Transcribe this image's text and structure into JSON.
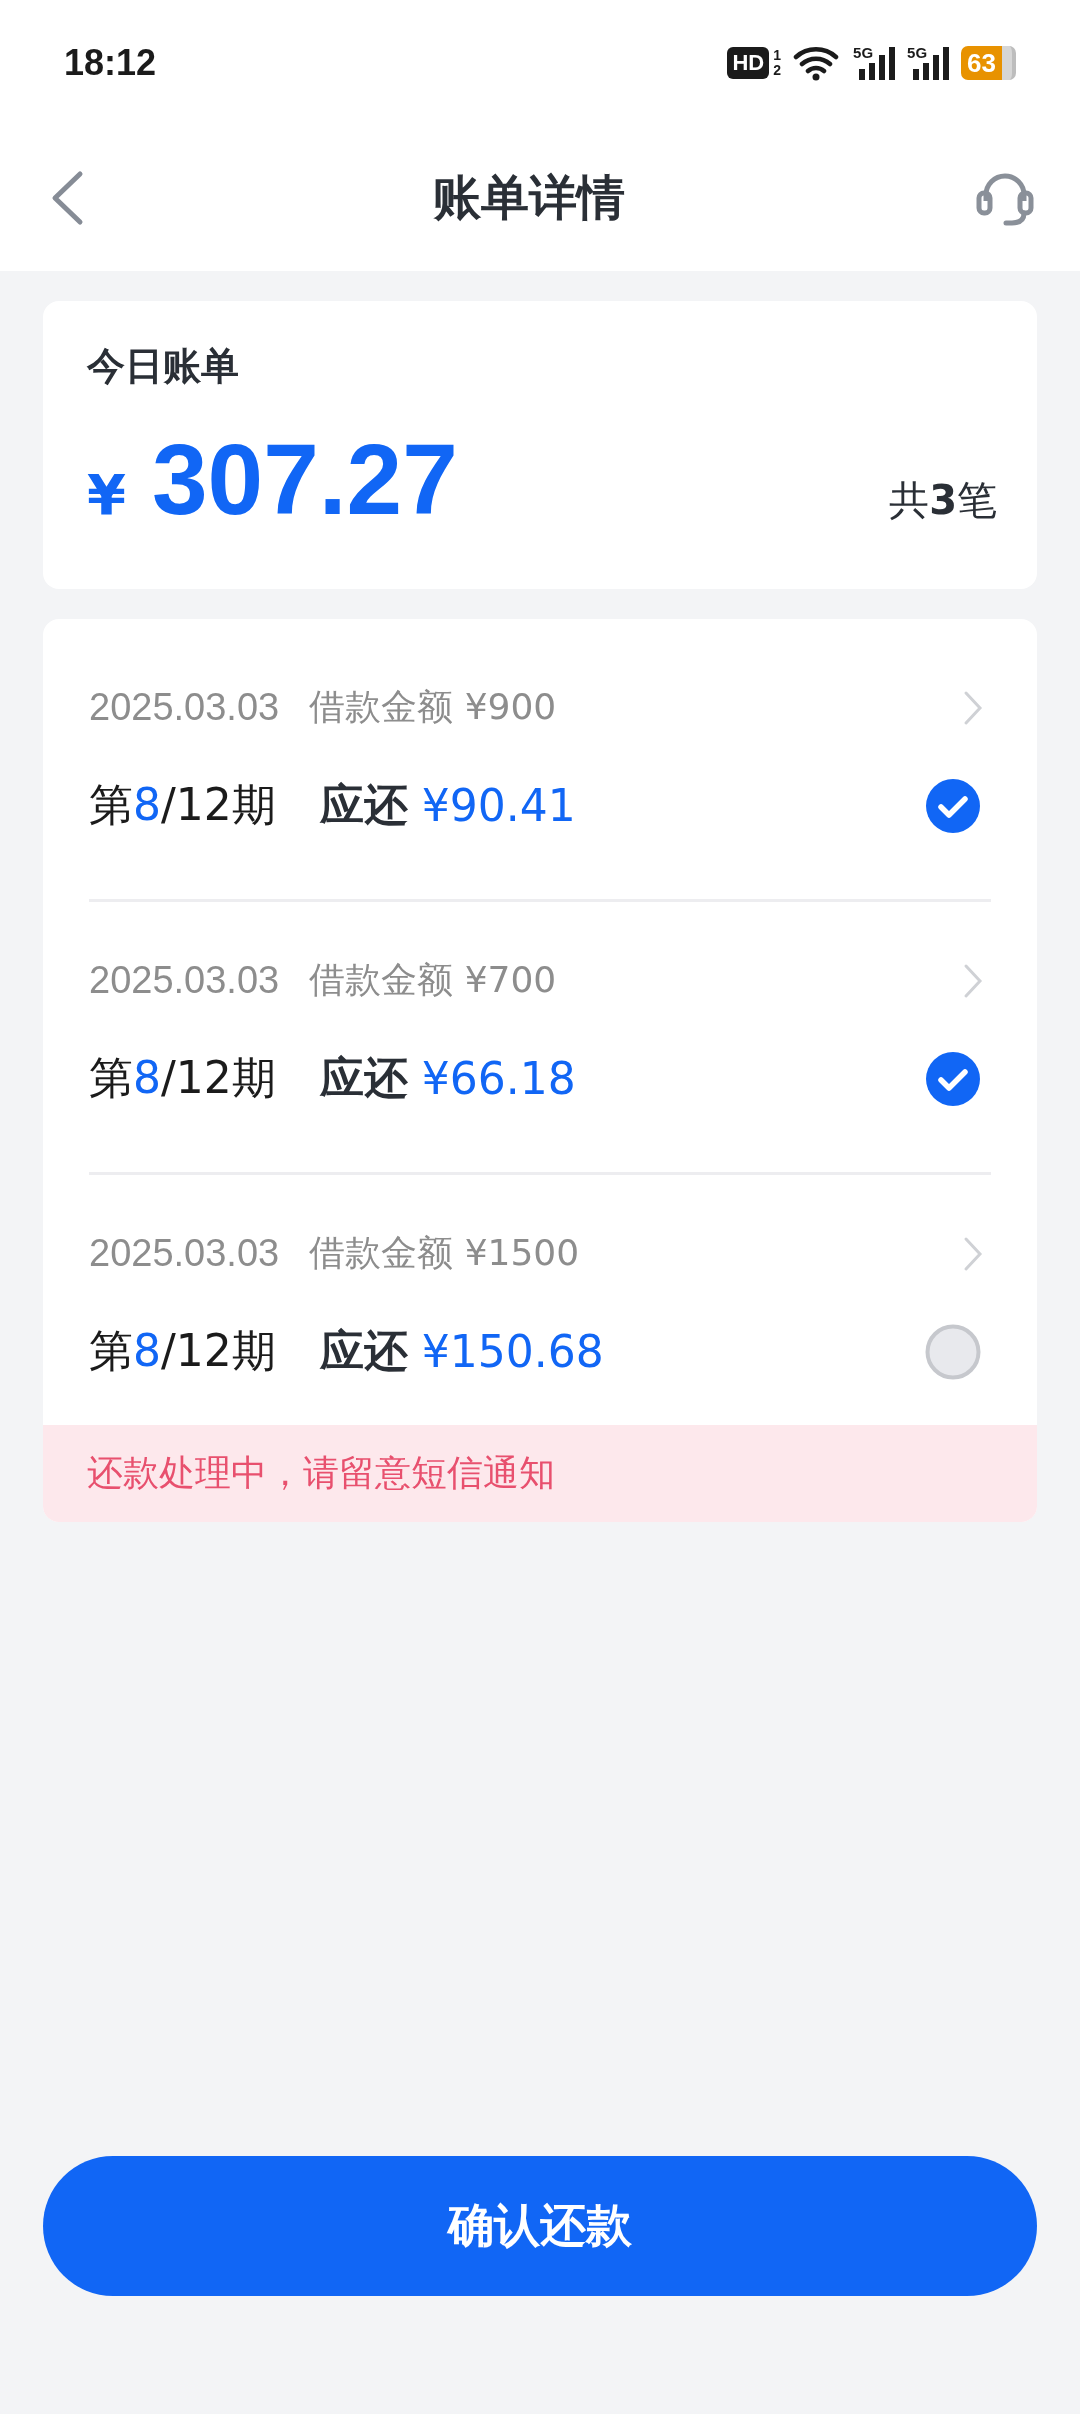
{
  "status_bar": {
    "time": "18:12",
    "hd": "HD",
    "hd_sub": [
      "1",
      "2"
    ],
    "networks": [
      "5G",
      "5G"
    ],
    "battery": "63"
  },
  "header": {
    "title": "账单详情"
  },
  "summary": {
    "title": "今日账单",
    "currency": "¥",
    "amount": "307.27",
    "count": "共**3**笔"
  },
  "bills": [
    {
      "date": "2025.03.03",
      "loan": "借款金额 ¥900",
      "period_before": "第",
      "period_current": "8",
      "period_after": "/12期",
      "due_label": "应还",
      "due_amount": "¥90.41",
      "selected": true
    },
    {
      "date": "2025.03.03",
      "loan": "借款金额 ¥700",
      "period_before": "第",
      "period_current": "8",
      "period_after": "/12期",
      "due_label": "应还",
      "due_amount": "¥66.18",
      "selected": true
    },
    {
      "date": "2025.03.03",
      "loan": "借款金额 ¥1500",
      "period_before": "第",
      "period_current": "8",
      "period_after": "/12期",
      "due_label": "应还",
      "due_amount": "¥150.68",
      "selected": false
    }
  ],
  "notice": "还款处理中，请留意短信通知",
  "confirm_button": "确认还款"
}
